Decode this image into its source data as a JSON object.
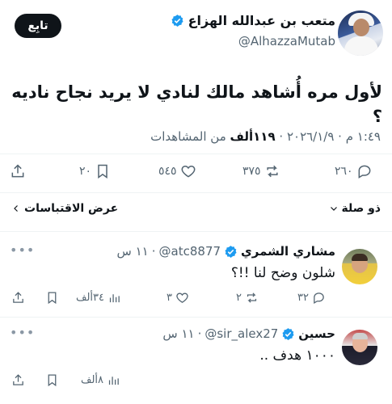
{
  "main_tweet": {
    "author_name": "متعب بن عبدالله الهزاع",
    "handle": "@AlhazzaMutab",
    "follow_label": "تابِع",
    "text": "لأول مره أُشاهد مالك لنادي لا يريد نجاح ناديه ؟",
    "timestamp": "١:٤٩ م · ٢٠٢٦/١/٩",
    "views_count": "١١٩ألف",
    "views_label": "من المشاهدات",
    "actions": {
      "replies": "٢٦٠",
      "reposts": "٣٧٥",
      "likes": "٥٤٥",
      "bookmarks": "٢٠"
    }
  },
  "sort": {
    "label": "ذو صلة",
    "quotes_label": "عرض الاقتباسات"
  },
  "replies": [
    {
      "name": "مشاري الشمري",
      "handle": "@atc8877",
      "time": "١١ س",
      "text": "شلون وضح لنا !!؟",
      "replies": "٣٢",
      "reposts": "٢",
      "likes": "٣",
      "views": "٣٤ألف"
    },
    {
      "name": "حسين",
      "handle": "@sir_alex27",
      "time": "١١ س",
      "text": "١٠٠٠ هدف ..",
      "views": "٨ألف"
    }
  ],
  "colors": {
    "text": "#0f1419",
    "secondary": "#536471",
    "verified": "#1d9bf0",
    "divider": "#eff3f4"
  }
}
